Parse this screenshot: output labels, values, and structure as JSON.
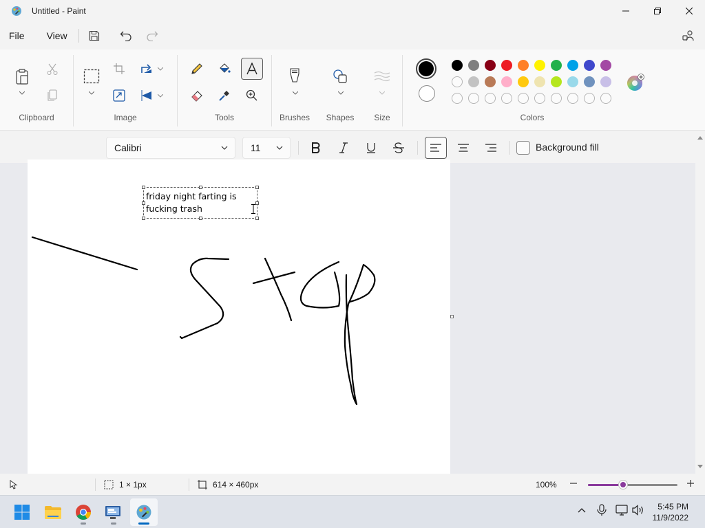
{
  "window": {
    "title": "Untitled - Paint"
  },
  "menu": {
    "file": "File",
    "view": "View"
  },
  "ribbon": {
    "groups": {
      "clipboard": "Clipboard",
      "image": "Image",
      "tools": "Tools",
      "brushes": "Brushes",
      "shapes": "Shapes",
      "size": "Size",
      "colors": "Colors"
    },
    "primary_color": "#000000",
    "secondary_color": "#ffffff",
    "palette_row1": [
      "#000000",
      "#7f7f7f",
      "#880015",
      "#ed1c24",
      "#ff7f27",
      "#fff200",
      "#22b14c",
      "#00a2e8",
      "#3f48cc",
      "#a349a4"
    ],
    "palette_row2": [
      "",
      "#c3c3c3",
      "#b97a57",
      "#ffaec9",
      "#ffc90e",
      "#efe4b0",
      "#b5e61d",
      "#99d9ea",
      "#7092be",
      "#c8bfe7"
    ],
    "palette_row3": [
      "",
      "",
      "",
      "",
      "",
      "",
      "",
      "",
      "",
      ""
    ]
  },
  "text_toolbar": {
    "font": "Calibri",
    "size": "11",
    "background_fill_label": "Background fill",
    "background_fill_checked": false,
    "alignment": "left"
  },
  "canvas": {
    "textbox_text": "friday night farting is fucking trash"
  },
  "status": {
    "selection_size": "1 × 1px",
    "canvas_size": "614 × 460px",
    "zoom": "100%",
    "zoom_level": 0.39
  },
  "taskbar": {
    "time": "5:45 PM",
    "date": "11/9/2022"
  }
}
